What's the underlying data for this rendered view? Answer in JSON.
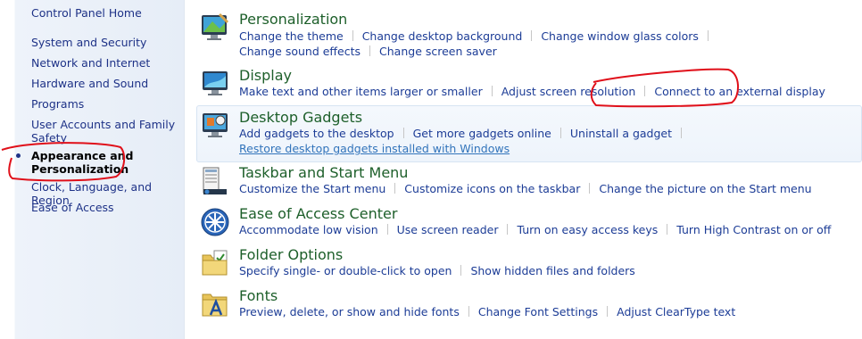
{
  "sidebar": {
    "items": [
      {
        "label": "Control Panel Home"
      },
      {
        "label": "System and Security"
      },
      {
        "label": "Network and Internet"
      },
      {
        "label": "Hardware and Sound"
      },
      {
        "label": "Programs"
      },
      {
        "label": "User Accounts and Family"
      },
      {
        "label": "Safety"
      },
      {
        "label": "Appearance and"
      },
      {
        "label": "Personalization"
      },
      {
        "label": "Clock, Language, and Region"
      },
      {
        "label": "Ease of Access"
      }
    ]
  },
  "categories": [
    {
      "title": "Personalization",
      "icon": "personalization-icon",
      "links": [
        "Change the theme",
        "Change desktop background",
        "Change window glass colors",
        "Change sound effects",
        "Change screen saver"
      ]
    },
    {
      "title": "Display",
      "icon": "display-icon",
      "links": [
        "Make text and other items larger or smaller",
        "Adjust screen resolution",
        "Connect to an external display"
      ]
    },
    {
      "title": "Desktop Gadgets",
      "icon": "gadgets-icon",
      "links": [
        "Add gadgets to the desktop",
        "Get more gadgets online",
        "Uninstall a gadget",
        "Restore desktop gadgets installed with Windows"
      ]
    },
    {
      "title": "Taskbar and Start Menu",
      "icon": "taskbar-icon",
      "links": [
        "Customize the Start menu",
        "Customize icons on the taskbar",
        "Change the picture on the Start menu"
      ]
    },
    {
      "title": "Ease of Access Center",
      "icon": "ease-of-access-icon",
      "links": [
        "Accommodate low vision",
        "Use screen reader",
        "Turn on easy access keys",
        "Turn High Contrast on or off"
      ]
    },
    {
      "title": "Folder Options",
      "icon": "folder-options-icon",
      "links": [
        "Specify single- or double-click to open",
        "Show hidden files and folders"
      ]
    },
    {
      "title": "Fonts",
      "icon": "fonts-icon",
      "links": [
        "Preview, delete, or show and hide fonts",
        "Change Font Settings",
        "Adjust ClearType text"
      ]
    }
  ],
  "colors": {
    "link": "#1c3c96",
    "title": "#1d5f2a",
    "annotation": "#e0101a"
  }
}
